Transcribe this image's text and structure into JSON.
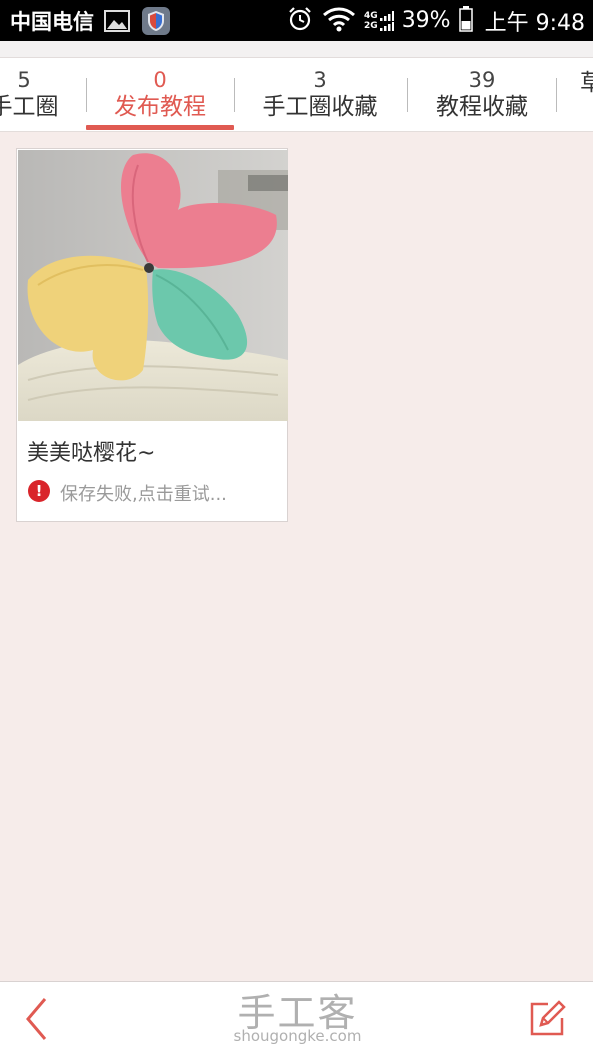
{
  "status_bar": {
    "carrier": "中国电信",
    "network_top": "4G",
    "network_bottom": "2G",
    "battery": "39%",
    "time": "上午 9:48"
  },
  "tabs": [
    {
      "count": "5",
      "label": "手工圈",
      "active": false
    },
    {
      "count": "0",
      "label": "发布教程",
      "active": true
    },
    {
      "count": "3",
      "label": "手工圈收藏",
      "active": false
    },
    {
      "count": "39",
      "label": "教程收藏",
      "active": false
    },
    {
      "count": "",
      "label": "草",
      "active": false
    }
  ],
  "card": {
    "title": "美美哒樱花~",
    "status_icon": "!",
    "status_text": "保存失败,点击重试..."
  },
  "bottom_bar": {
    "brand_cn": "手工客",
    "brand_en": "shougongke.com"
  },
  "colors": {
    "accent": "#e05a52",
    "background": "#f6ecea",
    "error": "#d9252b"
  },
  "icons": {
    "back": "chevron-left-icon",
    "edit": "pencil-square-icon",
    "error": "exclamation-circle-icon"
  }
}
